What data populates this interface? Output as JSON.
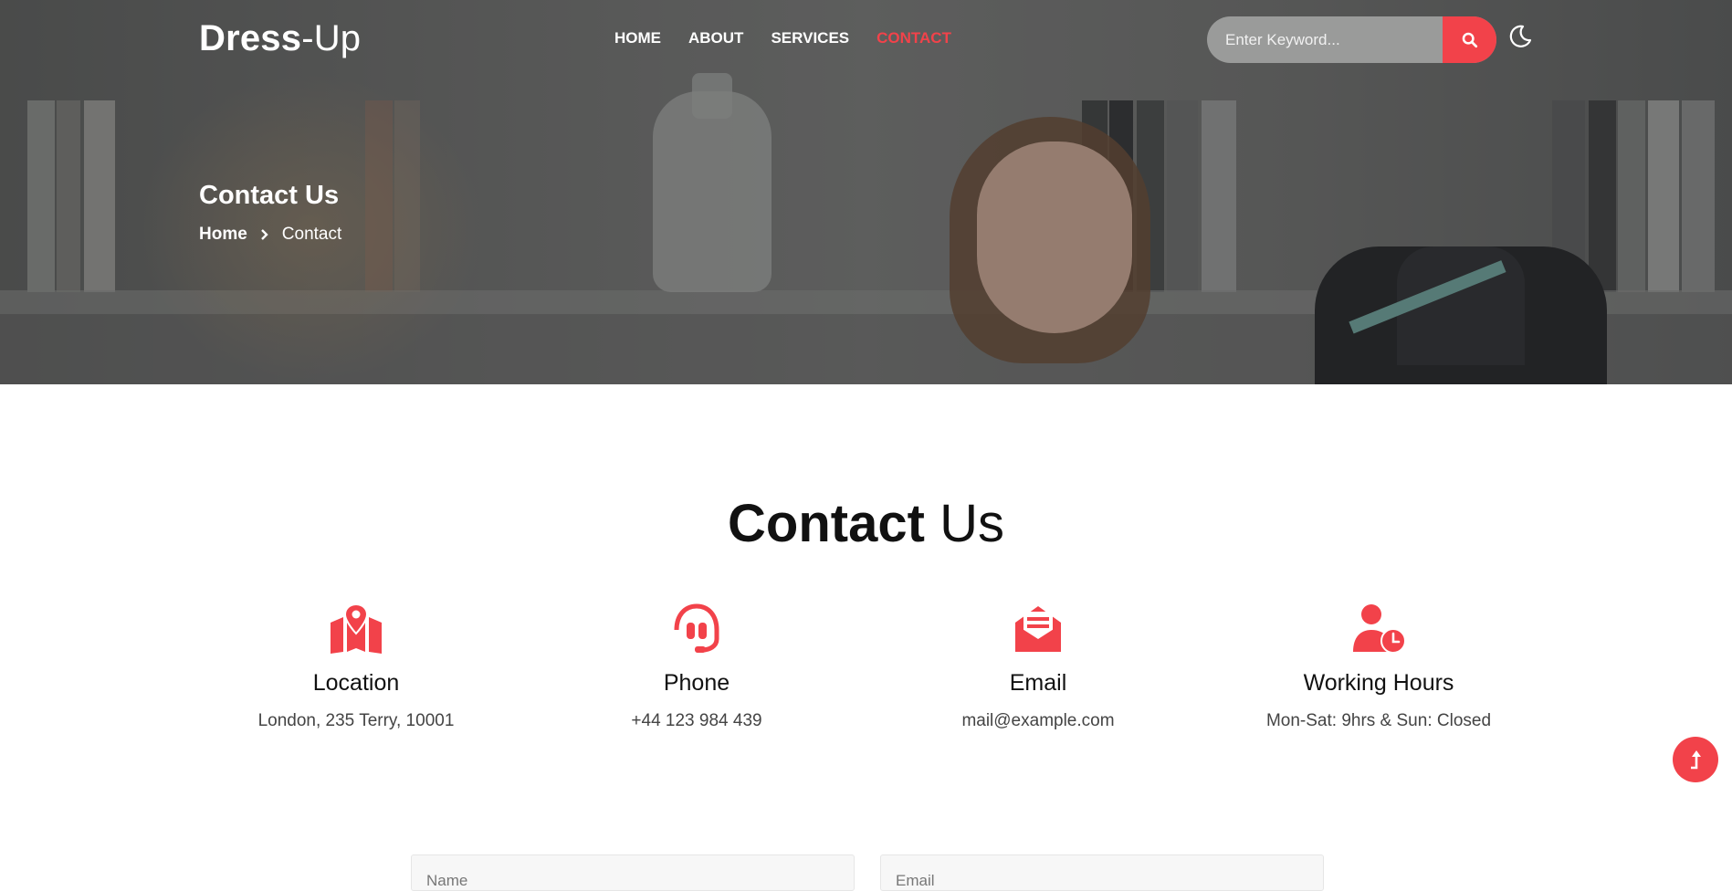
{
  "brand": {
    "name_bold": "Dress",
    "name_light": "-Up"
  },
  "nav": {
    "items": [
      {
        "label": "HOME"
      },
      {
        "label": "ABOUT"
      },
      {
        "label": "SERVICES"
      },
      {
        "label": "CONTACT",
        "active": true
      }
    ]
  },
  "search": {
    "placeholder": "Enter Keyword..."
  },
  "hero": {
    "title": "Contact Us",
    "breadcrumb": {
      "home": "Home",
      "current": "Contact"
    }
  },
  "contact_section": {
    "title_bold": "Contact",
    "title_light": "Us",
    "cards": [
      {
        "icon": "map-location-icon",
        "title": "Location",
        "value": "London, 235 Terry, 10001"
      },
      {
        "icon": "headset-icon",
        "title": "Phone",
        "value": "+44 123 984 439"
      },
      {
        "icon": "envelope-open-icon",
        "title": "Email",
        "value": "mail@example.com"
      },
      {
        "icon": "user-clock-icon",
        "title": "Working Hours",
        "value": "Mon-Sat: 9hrs & Sun: Closed"
      }
    ]
  },
  "form": {
    "name_placeholder": "Name",
    "email_placeholder": "Email"
  },
  "colors": {
    "accent": "#f2424a"
  }
}
